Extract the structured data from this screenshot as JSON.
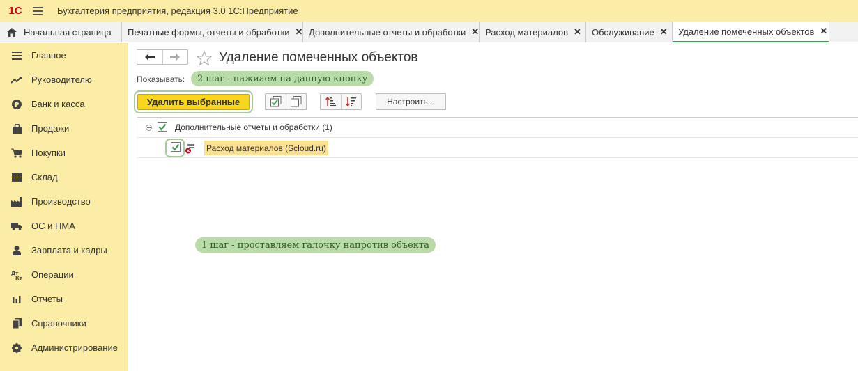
{
  "app": {
    "logo_text": "1С",
    "title": "Бухгалтерия предприятия, редакция 3.0 1С:Предприятие"
  },
  "tabs": [
    {
      "label": "Начальная страница",
      "closable": false
    },
    {
      "label": "Печатные формы, отчеты и обработки",
      "closable": true
    },
    {
      "label": "Дополнительные отчеты и обработки",
      "closable": true
    },
    {
      "label": "Расход материалов",
      "closable": true
    },
    {
      "label": "Обслуживание",
      "closable": true
    },
    {
      "label": "Удаление помеченных объектов",
      "closable": true,
      "active": true
    }
  ],
  "tab_close_glyph": "✕",
  "sidebar": {
    "items": [
      {
        "label": "Главное",
        "icon": "list-icon"
      },
      {
        "label": "Руководителю",
        "icon": "trend-icon"
      },
      {
        "label": "Банк и касса",
        "icon": "ruble-coin-icon"
      },
      {
        "label": "Продажи",
        "icon": "shopping-bag-icon"
      },
      {
        "label": "Покупки",
        "icon": "cart-icon"
      },
      {
        "label": "Склад",
        "icon": "warehouse-grid-icon"
      },
      {
        "label": "Производство",
        "icon": "factory-icon"
      },
      {
        "label": "ОС и НМА",
        "icon": "truck-icon"
      },
      {
        "label": "Зарплата и кадры",
        "icon": "person-icon"
      },
      {
        "label": "Операции",
        "icon": "dt-kt-icon"
      },
      {
        "label": "Отчеты",
        "icon": "bar-chart-icon"
      },
      {
        "label": "Справочники",
        "icon": "book-icon"
      },
      {
        "label": "Администрирование",
        "icon": "gear-icon"
      }
    ]
  },
  "page": {
    "title": "Удаление помеченных объектов",
    "show_label": "Показывать:",
    "hint_step2": "2 шаг - нажиаем на данную кнопку",
    "hint_step1": "1 шаг - проставляем галочку напротив объекта",
    "delete_button": "Удалить выбранные",
    "setup_button": "Настроить..."
  },
  "tree": {
    "group": {
      "label": "Дополнительные отчеты и обработки (1)",
      "checked": true,
      "expanded": true
    },
    "items": [
      {
        "label": "Расход материалов (Scloud.ru)",
        "checked": true,
        "marked_for_deletion": true
      }
    ]
  },
  "colors": {
    "accent_yellow": "#fbeda6",
    "primary_button": "#f7d61d",
    "hint_green": "#b9dba7",
    "check_green": "#3c9b4c",
    "active_tab_underline": "#3c9b4c",
    "item_highlight": "#fbe08f"
  }
}
